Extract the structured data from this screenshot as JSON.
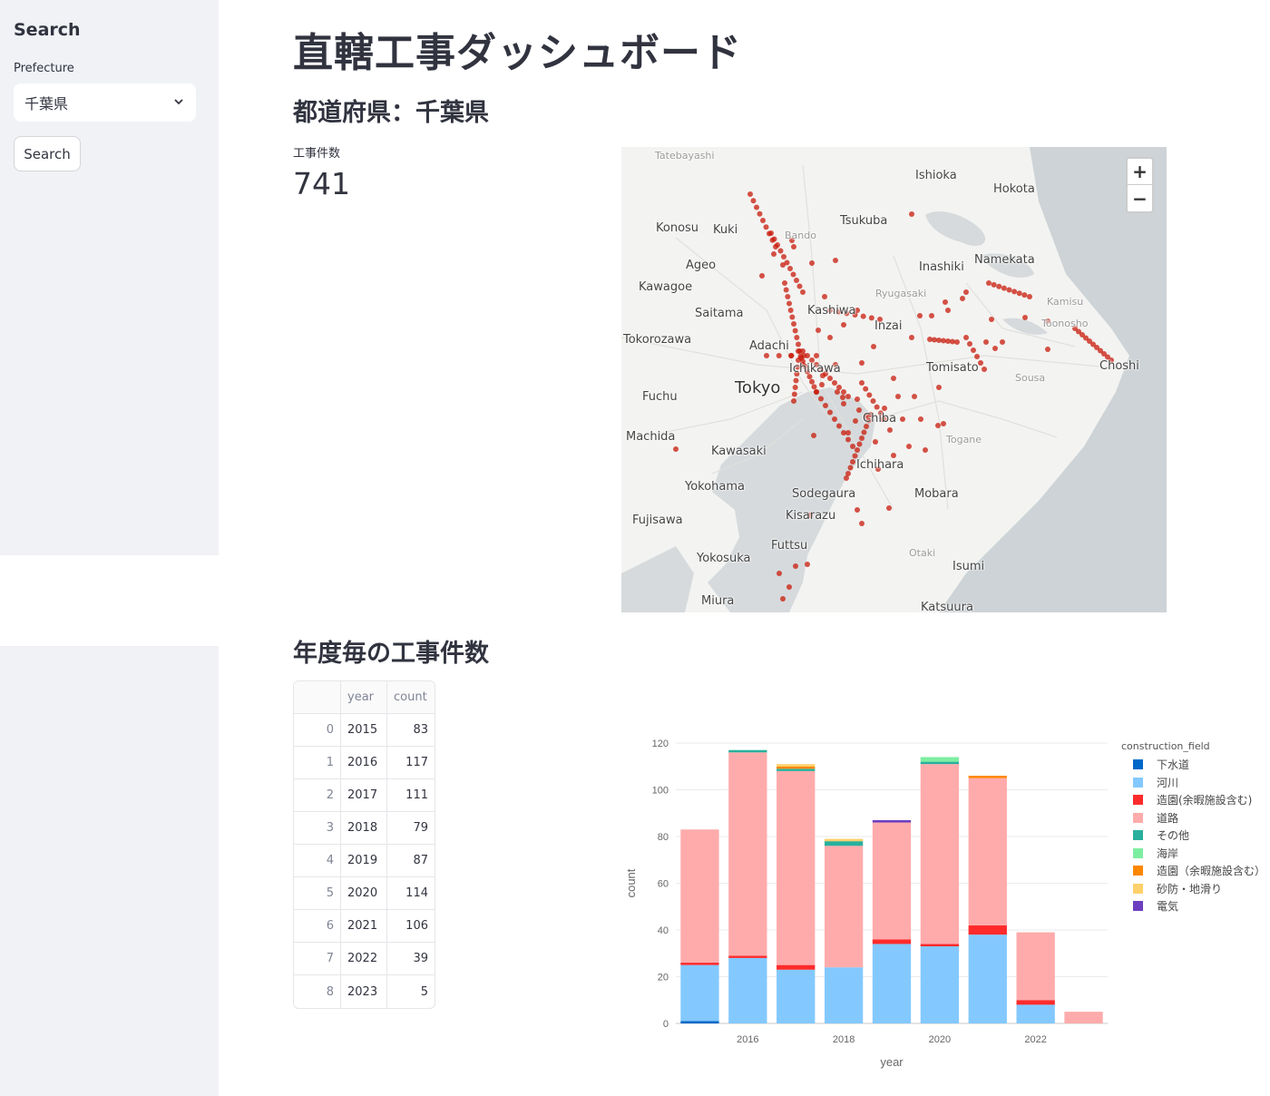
{
  "sidebar": {
    "title": "Search",
    "prefecture_label": "Prefecture",
    "prefecture_value": "千葉県",
    "search_button": "Search"
  },
  "main": {
    "title": "直轄工事ダッシュボード",
    "subheading": "都道府県：千葉県",
    "metric_label": "工事件数",
    "metric_value": "741",
    "section_title": "年度毎の工事件数"
  },
  "map": {
    "labels": [
      "Tatebayashi",
      "Ishioka",
      "Hokota",
      "Konosu",
      "Kuki",
      "Bando",
      "Tsukuba",
      "Ageo",
      "Inashiki",
      "Namekata",
      "Kawagoe",
      "Ryugasaki",
      "Kamisu",
      "Saitama",
      "Kashiwa",
      "Inzai",
      "Toonosho",
      "Tokorozawa",
      "Adachi",
      "Choshi",
      "Ichikawa",
      "Tomisato",
      "Sousa",
      "Tokyo",
      "Fuchu",
      "Chiba",
      "Togane",
      "Machida",
      "Kawasaki",
      "Ichihara",
      "Yokohama",
      "Sodegaura",
      "Mobara",
      "Fujisawa",
      "Kisarazu",
      "Futtsu",
      "Otaki",
      "Yokosuka",
      "Isumi",
      "Miura",
      "Katsuura"
    ],
    "zoom_in": "+",
    "zoom_out": "−",
    "marker_color": "#c8190a"
  },
  "table": {
    "headers": [
      "",
      "year",
      "count"
    ],
    "rows": [
      [
        "0",
        "2015",
        "83"
      ],
      [
        "1",
        "2016",
        "117"
      ],
      [
        "2",
        "2017",
        "111"
      ],
      [
        "3",
        "2018",
        "79"
      ],
      [
        "4",
        "2019",
        "87"
      ],
      [
        "5",
        "2020",
        "114"
      ],
      [
        "6",
        "2021",
        "106"
      ],
      [
        "7",
        "2022",
        "39"
      ],
      [
        "8",
        "2023",
        "5"
      ]
    ]
  },
  "chart_data": {
    "type": "bar",
    "stacked": true,
    "xlabel": "year",
    "ylabel": "count",
    "ylim": [
      0,
      120
    ],
    "yticks": [
      0,
      20,
      40,
      60,
      80,
      100,
      120
    ],
    "xticks": [
      "2016",
      "2018",
      "2020",
      "2022"
    ],
    "categories": [
      2015,
      2016,
      2017,
      2018,
      2019,
      2020,
      2021,
      2022,
      2023
    ],
    "legend_title": "construction_field",
    "legend_position": "right",
    "series": [
      {
        "name": "下水道",
        "color": "#0068c9",
        "values": [
          1,
          0,
          0,
          0,
          0,
          0,
          0,
          0,
          0
        ]
      },
      {
        "name": "河川",
        "color": "#83c9ff",
        "values": [
          24,
          28,
          23,
          24,
          34,
          33,
          38,
          8,
          0
        ]
      },
      {
        "name": "造園(余暇施設含む)",
        "color": "#ff2b2b",
        "values": [
          1,
          1,
          2,
          0,
          2,
          1,
          4,
          2,
          0
        ]
      },
      {
        "name": "道路",
        "color": "#ffabab",
        "values": [
          57,
          87,
          83,
          52,
          50,
          77,
          63,
          29,
          5
        ]
      },
      {
        "name": "その他",
        "color": "#29b09d",
        "values": [
          0,
          1,
          1,
          2,
          0,
          1,
          0,
          0,
          0
        ]
      },
      {
        "name": "海岸",
        "color": "#7defa1",
        "values": [
          0,
          0,
          0,
          0,
          0,
          2,
          0,
          0,
          0
        ]
      },
      {
        "name": "造園（余暇施設含む）",
        "color": "#ff8700",
        "values": [
          0,
          0,
          1,
          0,
          0,
          0,
          1,
          0,
          0
        ]
      },
      {
        "name": "砂防・地滑り",
        "color": "#ffd16a",
        "values": [
          0,
          0,
          1,
          1,
          0,
          0,
          0,
          0,
          0
        ]
      },
      {
        "name": "電気",
        "color": "#6d3fc0",
        "values": [
          0,
          0,
          0,
          0,
          1,
          0,
          0,
          0,
          0
        ]
      }
    ]
  }
}
